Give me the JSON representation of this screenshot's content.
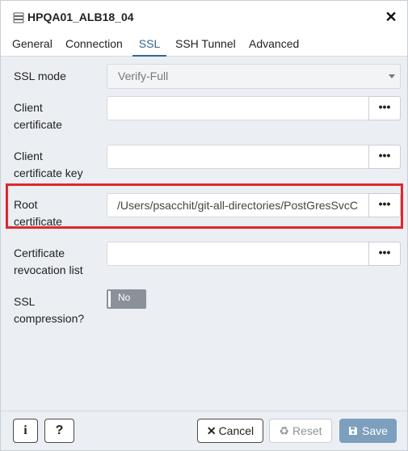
{
  "dialog": {
    "title": "HPQA01_ALB18_04",
    "server_icon": "server-icon",
    "close_label": "✕"
  },
  "tabs": [
    {
      "label": "General",
      "active": false
    },
    {
      "label": "Connection",
      "active": false
    },
    {
      "label": "SSL",
      "active": true
    },
    {
      "label": "SSH Tunnel",
      "active": false
    },
    {
      "label": "Advanced",
      "active": false
    }
  ],
  "form": {
    "ssl_mode": {
      "label": "SSL mode",
      "value": "Verify-Full"
    },
    "client_certificate": {
      "label_line1": "Client",
      "label_line2": "certificate",
      "value": ""
    },
    "client_certificate_key": {
      "label_line1": "Client",
      "label_line2": "certificate key",
      "value": ""
    },
    "root_certificate": {
      "label_line1": "Root",
      "label_line2": "certificate",
      "value": "/Users/psacchit/git-all-directories/PostGresSvcC"
    },
    "certificate_revocation_list": {
      "label_line1": "Certificate",
      "label_line2": "revocation list",
      "value": ""
    },
    "ssl_compression": {
      "label_line1": "SSL",
      "label_line2": "compression?",
      "value": "No"
    },
    "browse_label": "•••"
  },
  "footer": {
    "info_label": "i",
    "help_label": "?",
    "cancel_label": "Cancel",
    "reset_label": "Reset",
    "save_label": "Save"
  },
  "colors": {
    "accent": "#326690",
    "highlight": "#e2272b",
    "save_button": "#7d9fbe",
    "toggle_off": "#8a9199"
  }
}
